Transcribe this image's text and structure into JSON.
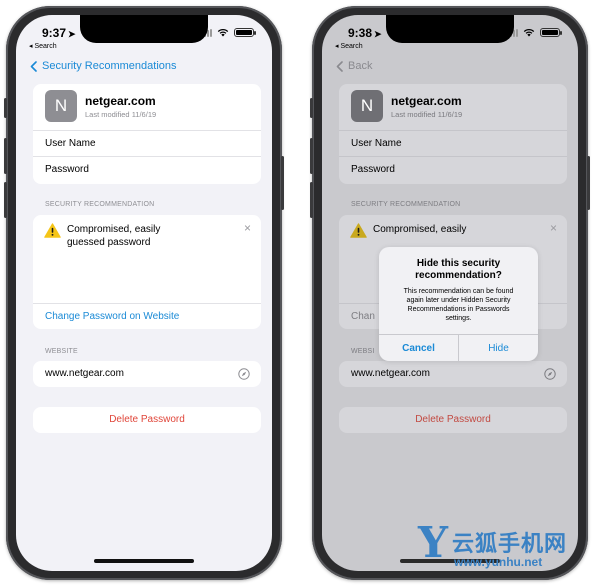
{
  "left_phone": {
    "status": {
      "time": "9:37",
      "back_label": "◂ Search"
    },
    "nav": {
      "back_label": "Security Recommendations"
    },
    "site": {
      "initial": "N",
      "name": "netgear.com",
      "modified": "Last modified 11/6/19"
    },
    "fields": {
      "user_name": "User Name",
      "password": "Password"
    },
    "security_section": "SECURITY RECOMMENDATION",
    "recommendation": {
      "text_line1": "Compromised, easily",
      "text_line2": "guessed password",
      "close": "×",
      "link": "Change Password on Website"
    },
    "website_section": "WEBSITE",
    "website": "www.netgear.com",
    "delete_label": "Delete Password"
  },
  "right_phone": {
    "status": {
      "time": "9:38",
      "back_label": "◂ Search"
    },
    "nav": {
      "back_label": "Back"
    },
    "site": {
      "initial": "N",
      "name": "netgear.com",
      "modified": "Last modified 11/6/19"
    },
    "fields": {
      "user_name": "User Name",
      "password": "Password"
    },
    "security_section": "SECURITY RECOMMENDATION",
    "recommendation": {
      "text_line1": "Compromised, easily",
      "close": "×",
      "link_partial": "Chan"
    },
    "website_section": "WEBSI",
    "website": "www.netgear.com",
    "delete_label": "Delete Password",
    "alert": {
      "title_line1": "Hide this security",
      "title_line2": "recommendation?",
      "message_line1": "This recommendation can be found",
      "message_line2": "again later under Hidden Security",
      "message_line3": "Recommendations in Passwords",
      "message_line4": "settings.",
      "cancel_label": "Cancel",
      "hide_label": "Hide"
    }
  },
  "watermark": {
    "logo_letter": "Y",
    "chinese": "云狐手机网",
    "url": "www.yunhu.net"
  },
  "colors": {
    "accent_blue": "#1a8ad6",
    "destructive_red": "#e0463a",
    "warning_yellow": "#f5c518",
    "watermark_blue": "#3b82c4"
  }
}
